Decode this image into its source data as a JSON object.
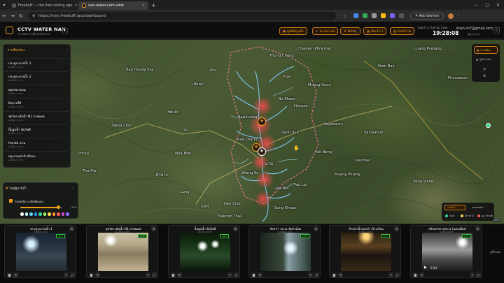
{
  "browser": {
    "tabs": [
      {
        "label": "Freebuff — the free coding age"
      },
      {
        "label": "nan-water-cam-view"
      }
    ],
    "url": "https://nan.freebuff.app/dashboard",
    "ask_gemini": "Ask Gemini"
  },
  "header": {
    "brand": "CCTV WATER NAN",
    "brand_sub": "ระบบเฝ้าระวังน้ำจังหวัดน่าน",
    "buttons": [
      "ศูนย์ข้อมูลน้ำ",
      "สถานการณ์",
      "Windy",
      "เปิด 4+3",
      "ฝ่ายสำรวจ"
    ],
    "date": "วันศุกร์ 13 สิงหาคม 2568",
    "time": "19:28:08",
    "user": "khan.ch7@gmail.com",
    "user_sub": "ผู้ดูแลระบบ"
  },
  "location_panel": {
    "title": "รายชื่อกล้อง",
    "items": [
      {
        "name": "ประตูระบายน้ำ 1",
        "sub": "อ.เมือง จ.น่าน"
      },
      {
        "name": "ประตูระบายน้ำ 2",
        "sub": "อ.เมือง จ.น่าน"
      },
      {
        "name": "ผดุงขนาดบน",
        "sub": "อ.เมือง จ.น่าน"
      },
      {
        "name": "ดิ่งภาคใต้",
        "sub": "อ.เมือง จ.น่าน"
      },
      {
        "name": "จุดวัดระดับน้ำ N1 ภาพแผล",
        "sub": "อ.เมือง จ.น่าน"
      },
      {
        "name": "ปั้มสูบน้ำ ต้นไพสี",
        "sub": "อ.เมือง จ.น่าน"
      },
      {
        "name": "Honda น่าน",
        "sub": "อ.เมือง จ.น่าน"
      },
      {
        "name": "ผดุงงานเฮาส์ ดรีมอะ",
        "sub": "อ.เมือง จ.น่าน"
      }
    ]
  },
  "filter_panel": {
    "title": "ไหล่ผู้ฉายน้ำ",
    "checkbox_label": "โหลดข้อ ระดับขีดแดง",
    "opacity_pct": "90%",
    "opacity_value": 0.9,
    "swatches": [
      "#ffffff",
      "#c7f4ff",
      "#5bd0ff",
      "#2a93ff",
      "#36d49a",
      "#9ef16a",
      "#ffd54a",
      "#ff9a3c",
      "#ff5a5a",
      "#d04bd0",
      "#8a6dff"
    ]
  },
  "right_panel": {
    "buttons": [
      "ดาวเทียม",
      "ภูมิประเทศ"
    ]
  },
  "legend": {
    "items": [
      "ระดับน้ำ",
      "ฝนตกหนัก",
      "ปกติ",
      "เฝ้าระวัง",
      "สูง / วิกฤติ"
    ]
  },
  "map": {
    "towns": [
      {
        "name": "พะเยา",
        "big": true
      },
      {
        "name": "เชียงคำ"
      },
      {
        "name": "ปง"
      },
      {
        "name": "เทิง"
      },
      {
        "name": "ลำปาง",
        "big": true
      },
      {
        "name": "แพร่",
        "big": true
      },
      {
        "name": "น่าน",
        "big": true
      },
      {
        "name": "Xayaboury"
      },
      {
        "name": "Luang Prabang"
      },
      {
        "name": "Pak Lai"
      },
      {
        "name": "Muang Phieng"
      },
      {
        "name": "Kenthao"
      },
      {
        "name": "Sainyabuli"
      },
      {
        "name": "Phonsavan"
      },
      {
        "name": "Vang Vieng"
      },
      {
        "name": "Nam Bak"
      },
      {
        "name": "Muang Houn"
      },
      {
        "name": "Hongsa"
      },
      {
        "name": "Thung Chang"
      },
      {
        "name": "Pua"
      },
      {
        "name": "Chaloem Phra Kiat"
      },
      {
        "name": "Ban Luang"
      },
      {
        "name": "Mae Charim"
      },
      {
        "name": "Na Noi"
      },
      {
        "name": "Wiang Sa"
      },
      {
        "name": "Santi Suk"
      },
      {
        "name": "Song Khwae"
      },
      {
        "name": "Bo Kluea"
      },
      {
        "name": "Nakhon Thai"
      },
      {
        "name": "Mae Moh"
      },
      {
        "name": "Long"
      },
      {
        "name": "Den Chai"
      },
      {
        "name": "Phrao"
      },
      {
        "name": "Wang Chin"
      },
      {
        "name": "Tha Pla"
      },
      {
        "name": "Pak Beng"
      },
      {
        "name": "Ban Houay Xay"
      }
    ],
    "markers": [
      {
        "label": "ประตูระบายน้ำ 1"
      },
      {
        "label": "ประตูระบายน้ำ 2"
      },
      {
        "label": "Honda น่าน"
      }
    ],
    "attribution": "Leaflet"
  },
  "cameras": [
    {
      "title": "ประตูระบายน้ำ 1",
      "sub": "อ.เมือง จ.น่าน",
      "live": "LIVE"
    },
    {
      "title": "จุดวัดระดับน้ำ N1 ภาพแผล",
      "sub": "อ.เมือง จ.น่าน",
      "live": "LIVE"
    },
    {
      "title": "ปั้มสูบน้ำ ต้นไพสี",
      "sub": "อ.เมือง จ.น่าน",
      "live": "LIVE"
    },
    {
      "title": "จังหว่า วรรณ วัดท่าม้อย",
      "sub": "อ.เมือง จ.น่าน",
      "live": "LIVE"
    },
    {
      "title": "ป้ายท่าน้ำดอนร้าวโรงเรียน",
      "sub": "อ.เมือง จ.น่าน",
      "live": "LIVE"
    },
    {
      "title": "กล้องท่าทางหลวง (นอกเมือง)",
      "sub": "อ.เมือง จ.น่าน",
      "live": "LIVE",
      "time": "0:24"
    }
  ],
  "side_button": "ดูทั้งหมด"
}
